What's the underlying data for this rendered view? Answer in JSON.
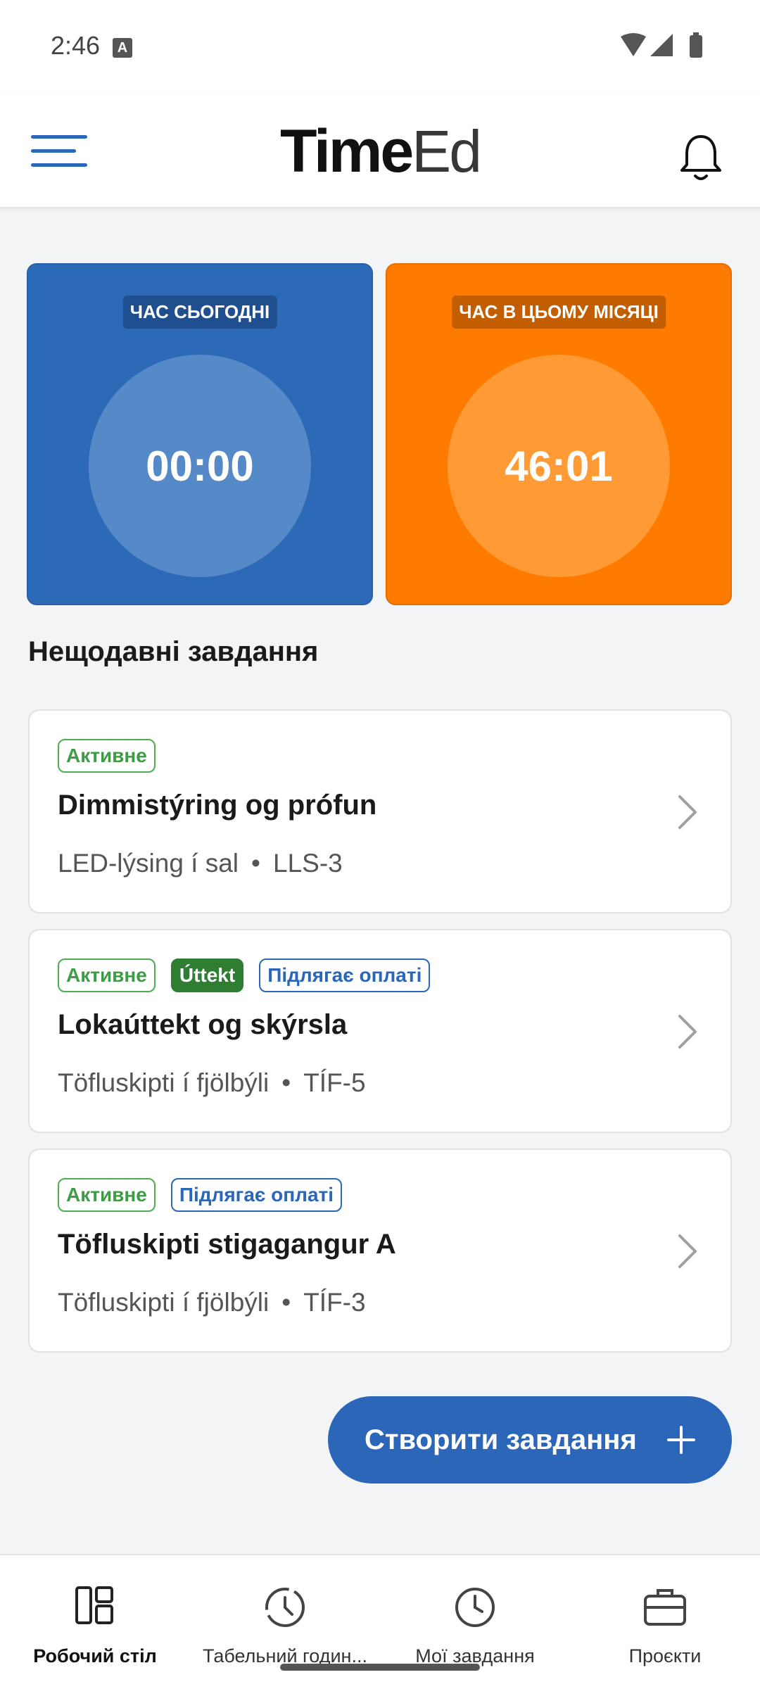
{
  "status_bar": {
    "time": "2:46",
    "notification_glyph": "A"
  },
  "app_bar": {
    "logo_bold": "Time",
    "logo_thin": "Ed"
  },
  "tiles": [
    {
      "label": "ЧАС СЬОГОДНІ",
      "value": "00:00",
      "color": "#2c6ab8"
    },
    {
      "label": "ЧАС В ЦЬОМУ МІСЯЦІ",
      "value": "46:01",
      "color": "#ff7b00"
    }
  ],
  "recent": {
    "title": "Нещодавні завдання",
    "tasks": [
      {
        "badges": [
          "Активне"
        ],
        "title": "Dimmistýring og prófun",
        "project": "LED-lýsing í sal",
        "code": "LLS-3"
      },
      {
        "badges": [
          "Активне",
          "Úttekt",
          "Підлягає оплаті"
        ],
        "title": "Lokaúttekt og skýrsla",
        "project": "Töfluskipti í fjölbýli",
        "code": "TÍF-5"
      },
      {
        "badges": [
          "Активне",
          "Підлягає оплаті"
        ],
        "title": "Töfluskipti stigagangur A",
        "project": "Töfluskipti í fjölbýli",
        "code": "TÍF-3"
      }
    ],
    "separator": "•"
  },
  "fab": {
    "label": "Створити завдання"
  },
  "bottom_nav": [
    {
      "label": "Робочий стіл",
      "icon": "dashboard-icon",
      "active": true
    },
    {
      "label": "Табельний годин...",
      "icon": "timesheet-icon",
      "active": false
    },
    {
      "label": "Мої завдання",
      "icon": "clock-icon",
      "active": false
    },
    {
      "label": "Проєкти",
      "icon": "briefcase-icon",
      "active": false
    }
  ],
  "colors": {
    "accent": "#2b66b8",
    "orange": "#ff7b00",
    "active_green": "#4caf50"
  }
}
